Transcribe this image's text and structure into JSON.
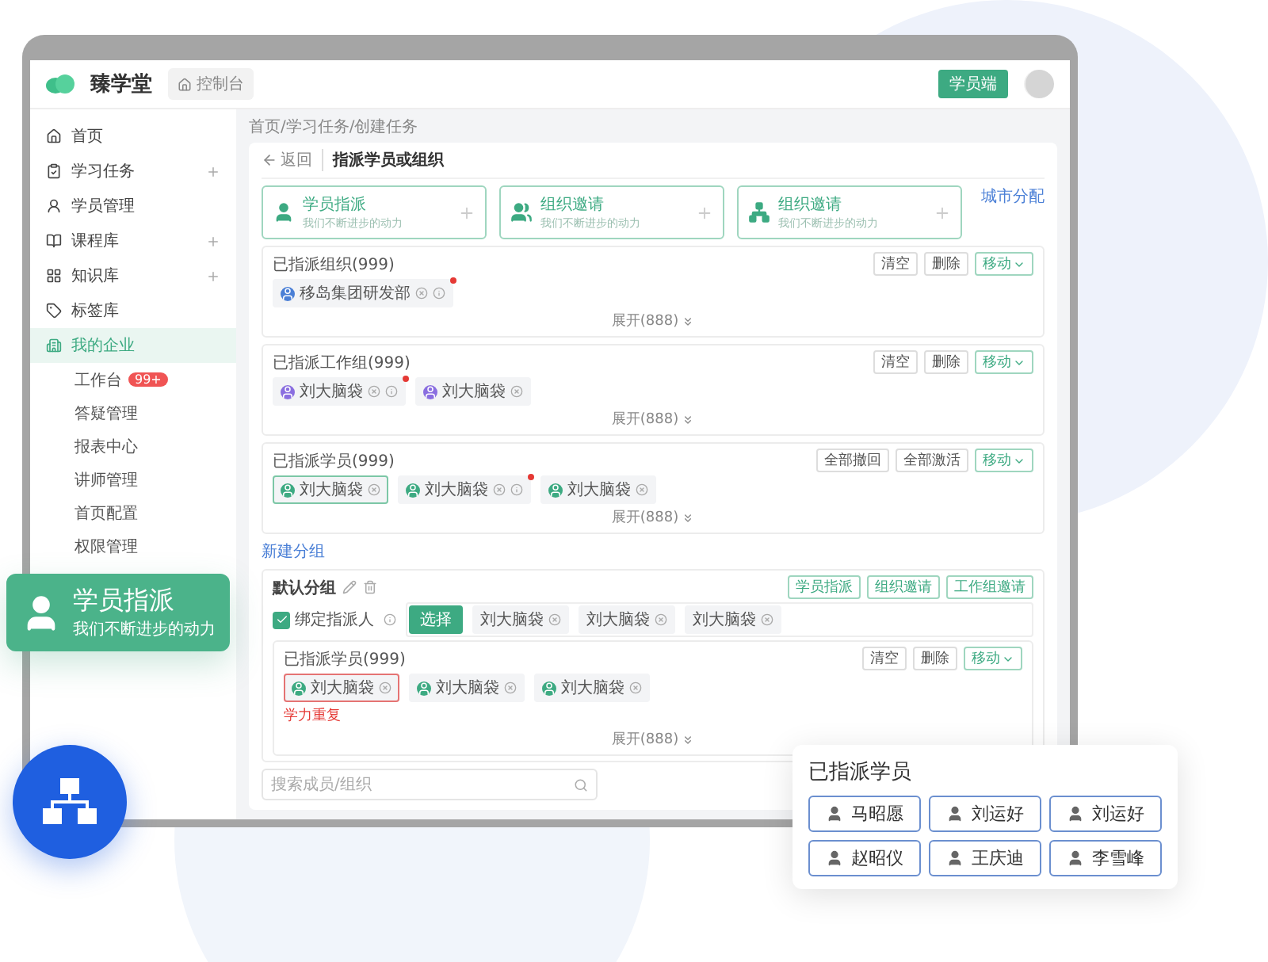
{
  "app": {
    "logo": "臻学堂",
    "console_tab": "控制台",
    "client_button": "学员端"
  },
  "sidebar": {
    "items": [
      {
        "label": "首页",
        "expandable": false,
        "selected": false
      },
      {
        "label": "学习任务",
        "expandable": true,
        "selected": false
      },
      {
        "label": "学员管理",
        "expandable": false,
        "selected": false
      },
      {
        "label": "课程库",
        "expandable": true,
        "selected": false
      },
      {
        "label": "知识库",
        "expandable": true,
        "selected": false
      },
      {
        "label": "标签库",
        "expandable": false,
        "selected": false
      },
      {
        "label": "我的企业",
        "expandable": false,
        "selected": true,
        "children": [
          {
            "label": "工作台",
            "badge": "99+"
          },
          {
            "label": "答疑管理"
          },
          {
            "label": "报表中心"
          },
          {
            "label": "讲师管理"
          },
          {
            "label": "首页配置"
          },
          {
            "label": "权限管理"
          }
        ]
      }
    ]
  },
  "breadcrumb": "首页/学习任务/创建任务",
  "page": {
    "back": "返回",
    "title": "指派学员或组织",
    "city_link": "城市分配"
  },
  "cards": [
    {
      "title": "学员指派",
      "subtitle": "我们不断进步的动力"
    },
    {
      "title": "组织邀请",
      "subtitle": "我们不断进步的动力"
    },
    {
      "title": "组织邀请",
      "subtitle": "我们不断进步的动力"
    }
  ],
  "sections": [
    {
      "title": "已指派组织(999)",
      "buttons": [
        {
          "label": "清空",
          "kind": "plain"
        },
        {
          "label": "删除",
          "kind": "plain"
        },
        {
          "label": "移动",
          "kind": "dropdown"
        }
      ],
      "tags": [
        {
          "name": "移岛集团研发部",
          "kind": "org",
          "flagged": true,
          "highlighted": false
        }
      ],
      "expand": "展开(888)"
    },
    {
      "title": "已指派工作组(999)",
      "buttons": [
        {
          "label": "清空",
          "kind": "plain"
        },
        {
          "label": "删除",
          "kind": "plain"
        },
        {
          "label": "移动",
          "kind": "dropdown"
        }
      ],
      "tags": [
        {
          "name": "刘大脑袋",
          "kind": "group",
          "flagged": true,
          "highlighted": false
        },
        {
          "name": "刘大脑袋",
          "kind": "group",
          "flagged": false,
          "highlighted": false
        }
      ],
      "expand": "展开(888)"
    },
    {
      "title": "已指派学员(999)",
      "buttons": [
        {
          "label": "全部撤回",
          "kind": "plain"
        },
        {
          "label": "全部激活",
          "kind": "plain"
        },
        {
          "label": "移动",
          "kind": "dropdown"
        }
      ],
      "tags": [
        {
          "name": "刘大脑袋",
          "kind": "student",
          "flagged": false,
          "highlighted": true
        },
        {
          "name": "刘大脑袋",
          "kind": "student",
          "flagged": true,
          "highlighted": false
        },
        {
          "name": "刘大脑袋",
          "kind": "student",
          "flagged": false,
          "highlighted": false
        }
      ],
      "expand": "展开(888)"
    }
  ],
  "new_group": "新建分组",
  "group": {
    "name": "默认分组",
    "actions": [
      "学员指派",
      "组织邀请",
      "工作组邀请"
    ],
    "checkbox": {
      "label": "绑定指派人",
      "checked": true
    },
    "select_button": "选择",
    "picked": [
      "刘大脑袋",
      "刘大脑袋",
      "刘大脑袋"
    ],
    "inner": {
      "title": "已指派学员(999)",
      "buttons": [
        {
          "label": "清空",
          "kind": "plain"
        },
        {
          "label": "删除",
          "kind": "plain"
        },
        {
          "label": "移动",
          "kind": "dropdown"
        }
      ],
      "tags": [
        {
          "name": "刘大脑袋",
          "kind": "student",
          "error": true
        },
        {
          "name": "刘大脑袋",
          "kind": "student",
          "error": false
        },
        {
          "name": "刘大脑袋",
          "kind": "student",
          "error": false
        }
      ],
      "error_text": "学力重复",
      "expand": "展开(888)"
    }
  },
  "search": {
    "placeholder": "搜索成员/组织"
  },
  "feature_card": {
    "title": "学员指派",
    "subtitle": "我们不断进步的动力"
  },
  "popover": {
    "title": "已指派学员",
    "students": [
      "马昭愿",
      "刘运好",
      "刘运好",
      "赵昭仪",
      "王庆迪",
      "李雪峰"
    ]
  }
}
